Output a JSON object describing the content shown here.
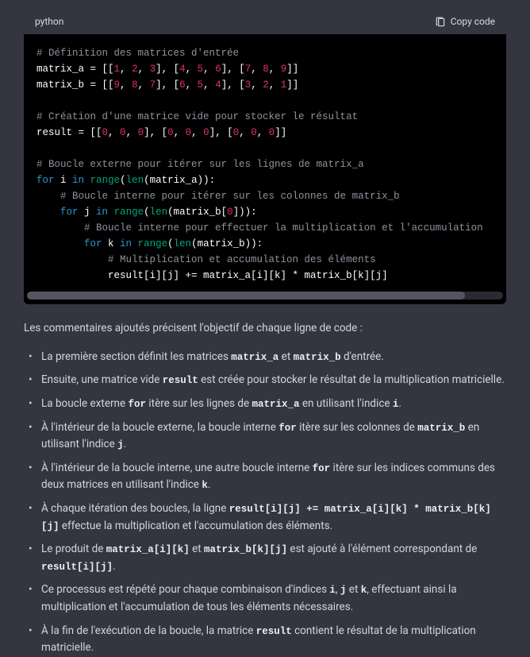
{
  "code_header": {
    "lang": "python",
    "copy_label": "Copy code"
  },
  "code": {
    "l1": "# Définition des matrices d'entrée",
    "l2a": "matrix_a = [[",
    "l2b": "1",
    "l2c": ", ",
    "l2d": "2",
    "l2e": ", ",
    "l2f": "3",
    "l2g": "], [",
    "l2h": "4",
    "l2i": ", ",
    "l2j": "5",
    "l2k": ", ",
    "l2l": "6",
    "l2m": "], [",
    "l2n": "7",
    "l2o": ", ",
    "l2p": "8",
    "l2q": ", ",
    "l2r": "9",
    "l2s": "]]",
    "l3a": "matrix_b = [[",
    "l3b": "9",
    "l3c": ", ",
    "l3d": "8",
    "l3e": ", ",
    "l3f": "7",
    "l3g": "], [",
    "l3h": "6",
    "l3i": ", ",
    "l3j": "5",
    "l3k": ", ",
    "l3l": "4",
    "l3m": "], [",
    "l3n": "3",
    "l3o": ", ",
    "l3p": "2",
    "l3q": ", ",
    "l3r": "1",
    "l3s": "]]",
    "l5": "# Création d'une matrice vide pour stocker le résultat",
    "l6a": "result = [[",
    "l6b": "0",
    "l6c": ", ",
    "l6d": "0",
    "l6e": ", ",
    "l6f": "0",
    "l6g": "], [",
    "l6h": "0",
    "l6i": ", ",
    "l6j": "0",
    "l6k": ", ",
    "l6l": "0",
    "l6m": "], [",
    "l6n": "0",
    "l6o": ", ",
    "l6p": "0",
    "l6q": ", ",
    "l6r": "0",
    "l6s": "]]",
    "l8": "# Boucle externe pour itérer sur les lignes de matrix_a",
    "l9a": "for",
    "l9b": " i ",
    "l9c": "in",
    "l9d": " ",
    "l9e": "range",
    "l9f": "(",
    "l9g": "len",
    "l9h": "(matrix_a)):",
    "l10": "    # Boucle interne pour itérer sur les colonnes de matrix_b",
    "l11a": "    ",
    "l11b": "for",
    "l11c": " j ",
    "l11d": "in",
    "l11e": " ",
    "l11f": "range",
    "l11g": "(",
    "l11h": "len",
    "l11i": "(matrix_b[",
    "l11j": "0",
    "l11k": "])):",
    "l12": "        # Boucle interne pour effectuer la multiplication et l'accumulation",
    "l13a": "        ",
    "l13b": "for",
    "l13c": " k ",
    "l13d": "in",
    "l13e": " ",
    "l13f": "range",
    "l13g": "(",
    "l13h": "len",
    "l13i": "(matrix_b)):",
    "l14": "            # Multiplication et accumulation des éléments",
    "l15": "            result[i][j] += matrix_a[i][k] * matrix_b[k][j]"
  },
  "intro": "Les commentaires ajoutés précisent l'objectif de chaque ligne de code :",
  "bullets": {
    "b1a": "La première section définit les matrices ",
    "b1b": "matrix_a",
    "b1c": " et ",
    "b1d": "matrix_b",
    "b1e": " d'entrée.",
    "b2a": "Ensuite, une matrice vide ",
    "b2b": "result",
    "b2c": " est créée pour stocker le résultat de la multiplication matricielle.",
    "b3a": "La boucle externe ",
    "b3b": "for",
    "b3c": " itère sur les lignes de ",
    "b3d": "matrix_a",
    "b3e": " en utilisant l'indice ",
    "b3f": "i",
    "b3g": ".",
    "b4a": "À l'intérieur de la boucle externe, la boucle interne ",
    "b4b": "for",
    "b4c": " itère sur les colonnes de ",
    "b4d": "matrix_b",
    "b4e": " en utilisant l'indice ",
    "b4f": "j",
    "b4g": ".",
    "b5a": "À l'intérieur de la boucle interne, une autre boucle interne ",
    "b5b": "for",
    "b5c": " itère sur les indices communs des deux matrices en utilisant l'indice ",
    "b5d": "k",
    "b5e": ".",
    "b6a": "À chaque itération des boucles, la ligne ",
    "b6b": "result[i][j] += matrix_a[i][k] * matrix_b[k][j]",
    "b6c": " effectue la multiplication et l'accumulation des éléments.",
    "b7a": "Le produit de ",
    "b7b": "matrix_a[i][k]",
    "b7c": " et ",
    "b7d": "matrix_b[k][j]",
    "b7e": " est ajouté à l'élément correspondant de ",
    "b7f": "result[i][j]",
    "b7g": ".",
    "b8a": "Ce processus est répété pour chaque combinaison d'indices ",
    "b8b": "i",
    "b8c": ", ",
    "b8d": "j",
    "b8e": " et ",
    "b8f": "k",
    "b8g": ", effectuant ainsi la multiplication et l'accumulation de tous les éléments nécessaires.",
    "b9a": "À la fin de l'exécution de la boucle, la matrice ",
    "b9b": "result",
    "b9c": " contient le résultat de la multiplication matricielle."
  }
}
